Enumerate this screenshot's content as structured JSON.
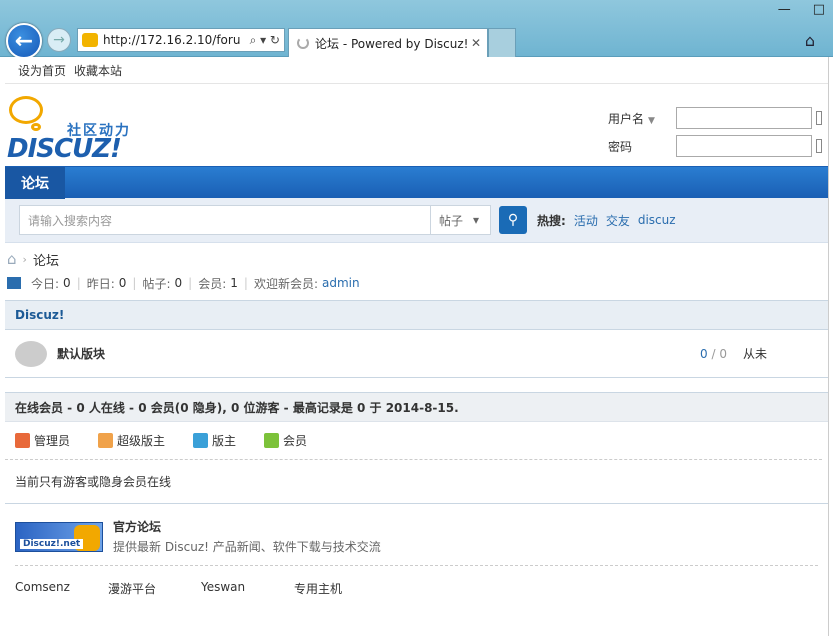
{
  "browser": {
    "url": "http://172.16.2.10/foru",
    "addr_controls": "⌕ ▾ ↻",
    "tab_title": "论坛 - Powered by Discuz!",
    "win_minimize": "—",
    "win_maximize": "□"
  },
  "topbar": {
    "set_home": "设为首页",
    "bookmark": "收藏本站"
  },
  "logo": {
    "tagline": "社区动力",
    "wordmark": "DISCUZ!"
  },
  "login": {
    "username_label": "用户名",
    "password_label": "密码"
  },
  "nav": {
    "current": "论坛"
  },
  "search": {
    "placeholder": "请输入搜索内容",
    "type": "帖子",
    "hot_label": "热搜:",
    "hot": [
      "活动",
      "交友",
      "discuz"
    ]
  },
  "breadcrumb": {
    "current": "论坛"
  },
  "stats": {
    "today_label": "今日:",
    "today": "0",
    "yesterday_label": "昨日:",
    "yesterday": "0",
    "posts_label": "帖子:",
    "posts": "0",
    "members_label": "会员:",
    "members": "1",
    "welcome_label": "欢迎新会员:",
    "newest": "admin"
  },
  "category": {
    "name": "Discuz!"
  },
  "forum": {
    "name": "默认版块",
    "threads": "0",
    "posts": "0",
    "separator": "/",
    "last": "从未"
  },
  "online": {
    "header": "在线会员 - 0 人在线 - 0 会员(0 隐身), 0 位游客 - 最高记录是 0 于 2014-8-15.",
    "legend": [
      "管理员",
      "超级版主",
      "版主",
      "会员"
    ],
    "legend_colors": [
      "#e8693a",
      "#f0a24a",
      "#3aa0d8",
      "#7cc23a"
    ],
    "text": "当前只有游客或隐身会员在线"
  },
  "links": {
    "official_title": "官方论坛",
    "official_desc": "提供最新 Discuz! 产品新闻、软件下载与技术交流",
    "badge_label": "Discuz!.net",
    "partners": [
      "Comsenz",
      "漫游平台",
      "Yeswan",
      "专用主机"
    ]
  }
}
